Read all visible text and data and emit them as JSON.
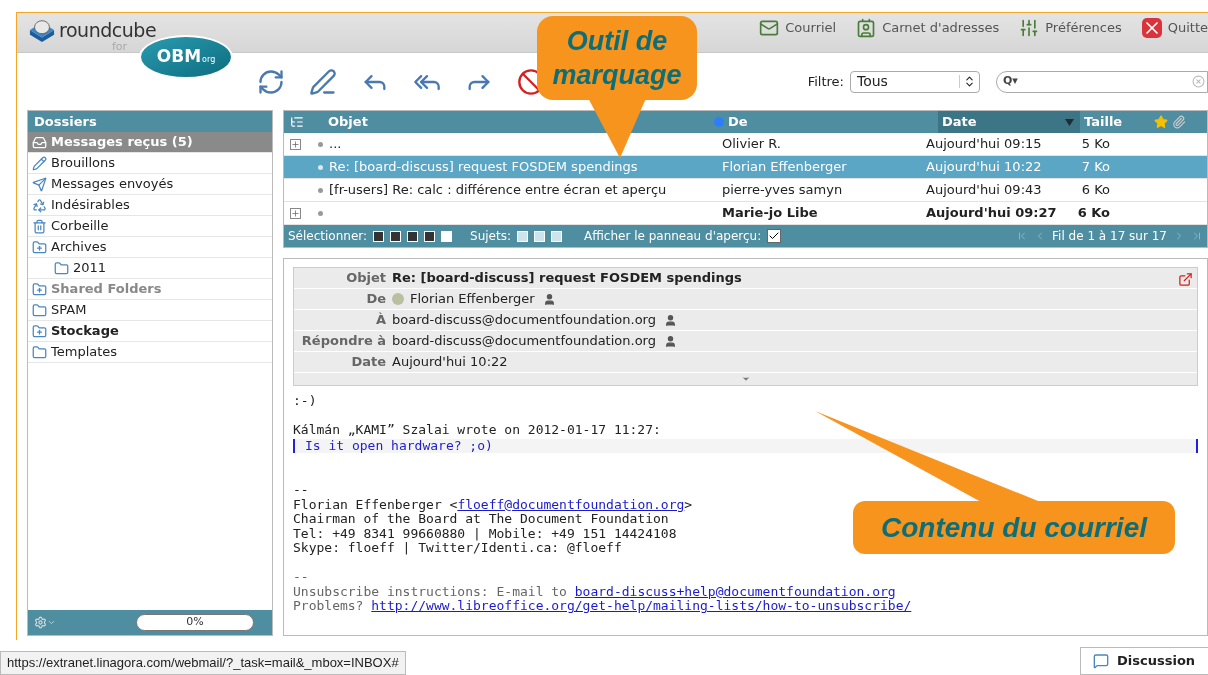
{
  "logo": {
    "name": "roundcube",
    "for": "for",
    "badge": "OBM",
    "badge_suffix": "org"
  },
  "nav": [
    {
      "label": "Courriel",
      "kind": "mail"
    },
    {
      "label": "Carnet d'adresses",
      "kind": "contacts"
    },
    {
      "label": "Préférences",
      "kind": "settings"
    },
    {
      "label": "Quitte",
      "kind": "quit"
    }
  ],
  "toolbar": [
    {
      "kind": "refresh"
    },
    {
      "kind": "compose"
    },
    {
      "kind": "reply"
    },
    {
      "kind": "reply-all"
    },
    {
      "kind": "forward"
    },
    {
      "kind": "delete"
    }
  ],
  "filter": {
    "label": "Filtre:",
    "value": "Tous"
  },
  "search": {
    "menu": "Q▾"
  },
  "folders_title": "Dossiers",
  "folders": [
    {
      "name": "Messages reçus (5)",
      "kind": "inbox",
      "selected": true,
      "bold": true,
      "muted": false
    },
    {
      "name": "Brouillons",
      "kind": "drafts",
      "selected": false,
      "bold": false,
      "muted": false
    },
    {
      "name": "Messages envoyés",
      "kind": "sent",
      "selected": false,
      "bold": false,
      "muted": false
    },
    {
      "name": "Indésirables",
      "kind": "junk",
      "selected": false,
      "bold": false,
      "muted": false
    },
    {
      "name": "Corbeille",
      "kind": "trash",
      "selected": false,
      "bold": false,
      "muted": false
    },
    {
      "name": "Archives",
      "kind": "folder-group",
      "selected": false,
      "bold": false,
      "muted": false,
      "children": [
        {
          "name": "2011",
          "kind": "folder",
          "selected": false,
          "bold": false,
          "muted": false
        }
      ]
    },
    {
      "name": "Shared Folders",
      "kind": "folder-group",
      "selected": false,
      "bold": true,
      "muted": true
    },
    {
      "name": "SPAM",
      "kind": "folder",
      "selected": false,
      "bold": false,
      "muted": false
    },
    {
      "name": "Stockage",
      "kind": "folder-group",
      "selected": false,
      "bold": true,
      "muted": false
    },
    {
      "name": "Templates",
      "kind": "folder",
      "selected": false,
      "bold": false,
      "muted": false
    }
  ],
  "quota": {
    "label": "0%"
  },
  "list_columns": {
    "subject": "Objet",
    "from": "De",
    "date": "Date",
    "size": "Taille"
  },
  "messages": [
    {
      "thread": true,
      "subject": "...",
      "from": "Olivier R.",
      "date": "Aujourd'hui 09:15",
      "size": "5 Ko",
      "selected": false,
      "unread": false
    },
    {
      "thread": false,
      "subject": "Re: [board-discuss] request FOSDEM spendings",
      "from": "Florian Effenberger",
      "date": "Aujourd'hui 10:22",
      "size": "7 Ko",
      "selected": true,
      "unread": false
    },
    {
      "thread": false,
      "subject": "[fr-users] Re: calc : différence entre écran et aperçu",
      "from": "pierre-yves samyn",
      "date": "Aujourd'hui 09:43",
      "size": "6 Ko",
      "selected": false,
      "unread": false
    },
    {
      "thread": true,
      "from": "Marie-jo Libe",
      "date": "Aujourd'hui 09:27",
      "size": "6 Ko",
      "selected": false,
      "unread": true
    }
  ],
  "list_footer": {
    "select_label": "Sélectionner:",
    "threads_label": "Sujets:",
    "preview_label": "Afficher le panneau d'aperçu:",
    "preview_checked": true,
    "pager": "Fil de 1 à 17 sur 17"
  },
  "headers": [
    {
      "label": "Objet",
      "value": "Re: [board-discuss] request FOSDEM spendings",
      "kind": "subject"
    },
    {
      "label": "De",
      "value": "Florian Effenberger",
      "kind": "sender"
    },
    {
      "label": "À",
      "value": "board-discuss@documentfoundation.org",
      "kind": "address"
    },
    {
      "label": "Répondre à",
      "value": "board-discuss@documentfoundation.org",
      "kind": "address"
    },
    {
      "label": "Date",
      "value": "Aujourd'hui 10:22",
      "kind": "plain"
    }
  ],
  "body": [
    {
      "kind": "text",
      "text": ":-)"
    },
    {
      "kind": "gap"
    },
    {
      "kind": "text",
      "text": "Kálmán „KAMI” Szalai wrote on 2012-01-17 11:27:"
    },
    {
      "kind": "quote",
      "text": "Is it open hardware? ;o)"
    },
    {
      "kind": "gap"
    },
    {
      "kind": "gap"
    },
    {
      "kind": "text",
      "text": "--"
    },
    {
      "kind": "link-line",
      "before": "Florian Effenberger <",
      "link": "floeff@documentfoundation.org",
      "after": ">"
    },
    {
      "kind": "text",
      "text": "Chairman of the Board at The Document Foundation"
    },
    {
      "kind": "text",
      "text": "Tel: +49 8341 99660880 | Mobile: +49 151 14424108"
    },
    {
      "kind": "text",
      "text": "Skype: floeff | Twitter/Identi.ca: @floeff"
    },
    {
      "kind": "gap"
    },
    {
      "kind": "muted",
      "text": "--"
    },
    {
      "kind": "link-line-muted",
      "before": "Unsubscribe instructions: E-mail to ",
      "link": "board-discuss+help@documentfoundation.org"
    },
    {
      "kind": "link-line-muted",
      "before": "Problems? ",
      "link": "http://www.libreoffice.org/get-help/mailing-lists/how-to-unsubscribe/"
    }
  ],
  "callouts": [
    {
      "text": "Outil de marquage",
      "kind": "top"
    },
    {
      "text": "Contenu du courriel",
      "kind": "bottom"
    }
  ],
  "status_url": "https://extranet.linagora.com/webmail/?_task=mail&_mbox=INBOX#",
  "chat_button": "Discussion"
}
